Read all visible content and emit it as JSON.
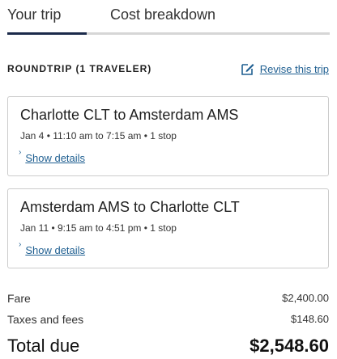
{
  "tabs": [
    {
      "label": "Your trip"
    },
    {
      "label": "Cost breakdown"
    }
  ],
  "trip": {
    "heading": "ROUNDTRIP (1 TRAVELER)",
    "revise_label": "Revise this trip",
    "revise_icon": "edit-icon"
  },
  "flights": [
    {
      "route": "Charlotte CLT to Amsterdam AMS",
      "meta": "Jan 4 • 11:10 am to 7:15 am • 1 stop",
      "details_label": "Show details"
    },
    {
      "route": "Amsterdam AMS to Charlotte CLT",
      "meta": "Jan 11 • 9:15 am to 4:51 pm • 1 stop",
      "details_label": "Show details"
    }
  ],
  "costs": {
    "fare_label": "Fare",
    "fare_value": "$2,400.00",
    "taxes_label": "Taxes and fees",
    "taxes_value": "$148.60",
    "total_label": "Total due",
    "total_value": "$2,548.60"
  },
  "colors": {
    "link": "#1f5f91",
    "active_tab": "#1b2a4a"
  }
}
